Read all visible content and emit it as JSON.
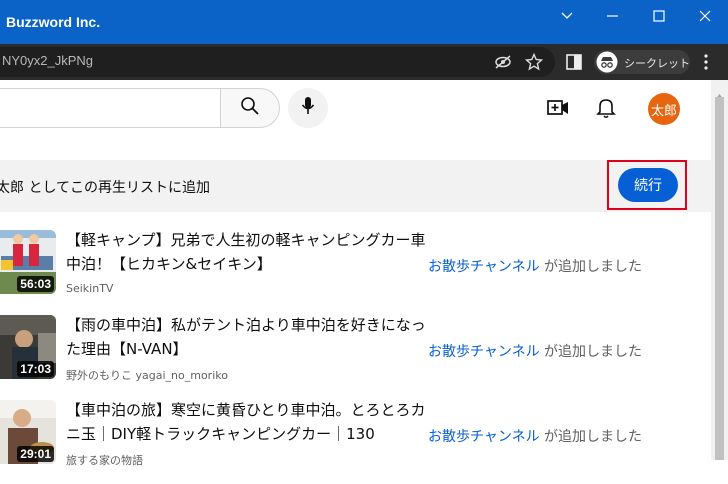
{
  "window": {
    "title": "Buzzword Inc."
  },
  "browser": {
    "url": "NY0yx2_JkPNg",
    "incognito_label": "シークレット"
  },
  "header": {
    "avatar_text": "太郎"
  },
  "banner": {
    "text": "太郎 としてこの再生リストに追加",
    "continue_label": "続行"
  },
  "videos": [
    {
      "title": "【軽キャンプ】兄弟で人生初の軽キャンピングカー車中泊！【ヒカキン&セイキン】",
      "channel": "SeikinTV",
      "duration": "56:03",
      "added_by": "お散歩チャンネル",
      "added_suffix": " が追加しました"
    },
    {
      "title": "【雨の車中泊】私がテント泊より車中泊を好きになった理由【N-VAN】",
      "channel": "野外のもりこ yagai_no_moriko",
      "duration": "17:03",
      "added_by": "お散歩チャンネル",
      "added_suffix": " が追加しました"
    },
    {
      "title": "【車中泊の旅】寒空に黄昏ひとり車中泊。とろとろカニ玉｜DIY軽トラックキャンピングカー｜130",
      "channel": "旅する家の物語",
      "duration": "29:01",
      "added_by": "お散歩チャンネル",
      "added_suffix": " が追加しました"
    }
  ],
  "colors": {
    "titlebar": "#0b63c7",
    "accent": "#065fd4",
    "avatar": "#e8650f",
    "highlight": "#e0001c"
  }
}
